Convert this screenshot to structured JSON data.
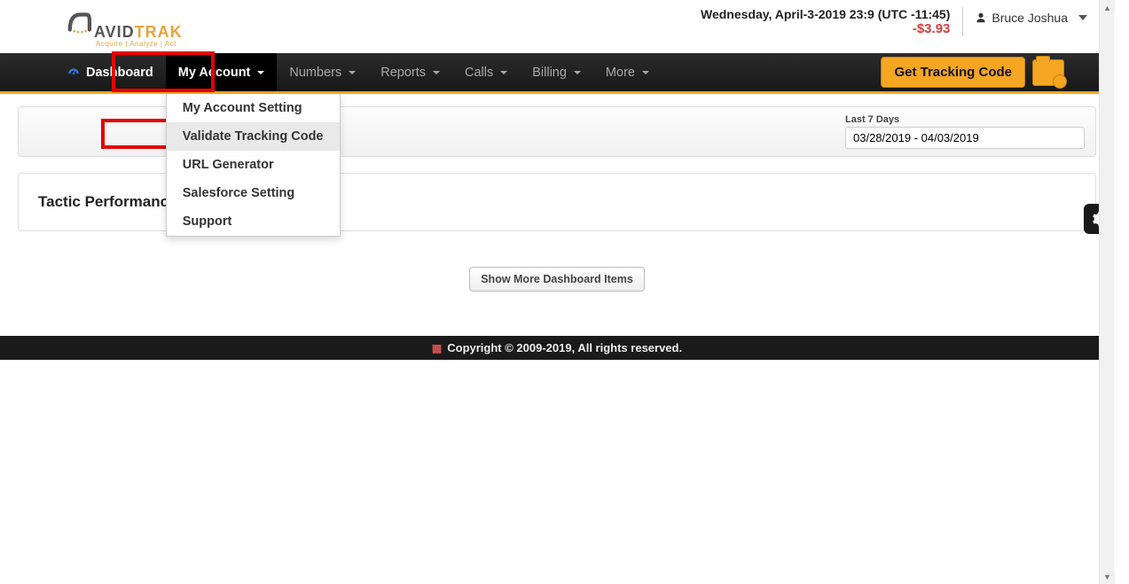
{
  "header": {
    "logo_brand_dark": "AVID",
    "logo_brand_orange": "TRAK",
    "logo_tagline": "Acquire  |  Analyze  |  Act",
    "datetime": "Wednesday, April-3-2019 23:9 (UTC -11:45)",
    "balance": "-$3.93",
    "user_name": "Bruce Joshua"
  },
  "nav": {
    "dashboard": "Dashboard",
    "my_account": "My Account",
    "numbers": "Numbers",
    "reports": "Reports",
    "calls": "Calls",
    "billing": "Billing",
    "more": "More",
    "tracking_btn": "Get Tracking Code"
  },
  "my_account_menu": {
    "items": [
      {
        "label": "My Account Setting"
      },
      {
        "label": "Validate Tracking Code"
      },
      {
        "label": "URL Generator"
      },
      {
        "label": "Salesforce Setting"
      },
      {
        "label": "Support"
      }
    ]
  },
  "date_filter": {
    "label": "Last 7 Days",
    "range": "03/28/2019 - 04/03/2019"
  },
  "panels": {
    "tactic_heading": "Tactic Performance",
    "show_more": "Show More Dashboard Items"
  },
  "footer": {
    "text": "Copyright © 2009-2019, All rights reserved."
  }
}
